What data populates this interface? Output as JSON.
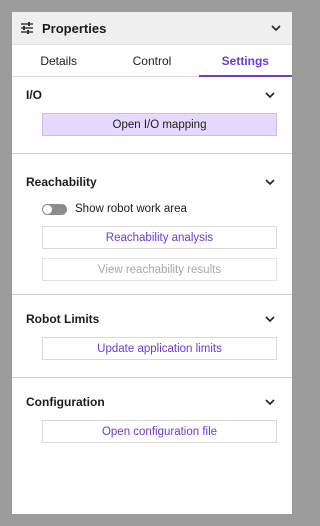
{
  "panel": {
    "title": "Properties",
    "icon": "sliders-icon"
  },
  "tabs": [
    {
      "label": "Details",
      "active": false
    },
    {
      "label": "Control",
      "active": false
    },
    {
      "label": "Settings",
      "active": true
    }
  ],
  "sections": {
    "io": {
      "title": "I/O",
      "button": "Open I/O mapping"
    },
    "reachability": {
      "title": "Reachability",
      "toggle_label": "Show robot work area",
      "toggle_on": false,
      "analysis_button": "Reachability analysis",
      "results_button": "View reachability results"
    },
    "robot_limits": {
      "title": "Robot Limits",
      "button": "Update application limits"
    },
    "configuration": {
      "title": "Configuration",
      "button": "Open configuration file"
    }
  },
  "colors": {
    "accent": "#6c3ad6",
    "primary_button_bg": "#e6d9ff",
    "header_bg": "#efefef",
    "backdrop": "#9b9b9b"
  }
}
